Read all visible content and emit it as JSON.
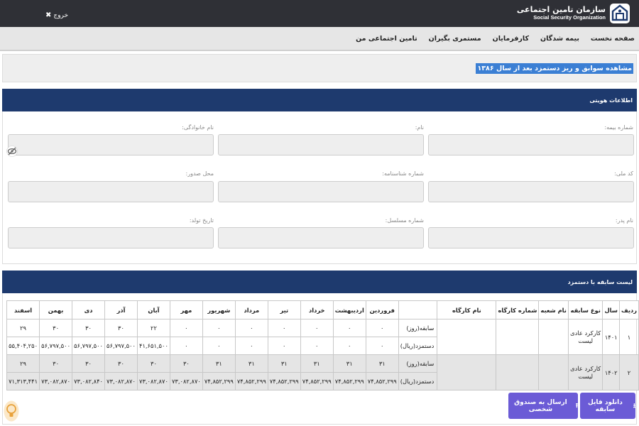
{
  "header": {
    "org_name_fa": "سازمان تامین اجتماعی",
    "org_name_en": "Social Security Organization",
    "logout_label": "خروج"
  },
  "nav": {
    "items": [
      "صفحه نخست",
      "بیمه شدگان",
      "کارفرمایان",
      "مستمری بگیران",
      "تامین اجتماعی من"
    ]
  },
  "page": {
    "title": "مشاهده سوابق و ریز دستمزد بعد از سال ۱۳۸۶"
  },
  "identity": {
    "title": "اطلاعات هویتی",
    "fields": {
      "insurance_number": "شماره بیمه:",
      "first_name": "نام:",
      "last_name": "نام خانوادگی:",
      "national_code": "کد ملی:",
      "id_number": "شماره شناسنامه:",
      "issue_place": "محل صدور:",
      "father_name": "نام پدر:",
      "serial_number": "شماره مسلسل:",
      "birth_date": "تاریخ تولد:"
    }
  },
  "history": {
    "title": "لیست سابقه با دستمزد",
    "columns": [
      "ردیف",
      "سال",
      "نوع سابقه",
      "نام شعبه",
      "شماره کارگاه",
      "نام کارگاه",
      "",
      "فروردین",
      "اردیبهشت",
      "خرداد",
      "تیر",
      "مرداد",
      "شهریور",
      "مهر",
      "آبان",
      "آذر",
      "دی",
      "بهمن",
      "اسفند"
    ],
    "rows": [
      {
        "row_no": "۱",
        "year": "۱۴۰۱",
        "type": "کارکرد عادی لیست",
        "branch": "",
        "workshop_no": "",
        "workshop_name": "",
        "days_label": "سابقه(روز)",
        "days": [
          "۰",
          "۰",
          "۰",
          "۰",
          "۰",
          "۰",
          "۰",
          "۲۲",
          "۳۰",
          "۳۰",
          "۳۰",
          "۲۹"
        ],
        "wage_label": "دستمزد(ریال)",
        "wages": [
          "۰",
          "۰",
          "۰",
          "۰",
          "۰",
          "۰",
          "۰",
          "۴۱,۶۵۱,۵۰۰",
          "۵۶,۷۹۷,۵۰۰",
          "۵۶,۷۹۷,۵۰۰",
          "۵۶,۷۹۷,۵۰۰",
          "۵۵,۴۰۴,۲۵۰"
        ]
      },
      {
        "row_no": "۲",
        "year": "۱۴۰۲",
        "type": "کارکرد عادی لیست",
        "branch": "",
        "workshop_no": "",
        "workshop_name": "",
        "days_label": "سابقه(روز)",
        "days": [
          "۳۱",
          "۳۱",
          "۳۱",
          "۳۱",
          "۳۱",
          "۳۱",
          "۳۰",
          "۳۰",
          "۳۰",
          "۳۰",
          "۳۰",
          "۲۹"
        ],
        "wage_label": "دستمزد(ریال)",
        "wages": [
          "۷۴,۸۵۲,۲۹۹",
          "۷۴,۸۵۲,۲۹۹",
          "۷۴,۸۵۲,۲۹۹",
          "۷۴,۸۵۲,۲۹۹",
          "۷۴,۸۵۲,۲۹۹",
          "۷۴,۸۵۲,۲۹۹",
          "۷۳,۰۸۲,۸۷۰",
          "۷۳,۰۸۲,۸۷۰",
          "۷۳,۰۸۲,۸۷۰",
          "۷۳,۰۸۲,۸۴۰",
          "۷۳,۰۸۲,۸۷۰",
          "۷۱,۳۱۳,۴۴۱"
        ]
      }
    ]
  },
  "actions": {
    "download_label": "دانلود فایل سابقه",
    "send_label": "ارسال به صندوق شخصی"
  },
  "colors": {
    "topbar": "#2f3036",
    "panel_header": "#1e3a6e",
    "button": "#6b5bd6",
    "title_highlight": "#3b7fd4"
  }
}
